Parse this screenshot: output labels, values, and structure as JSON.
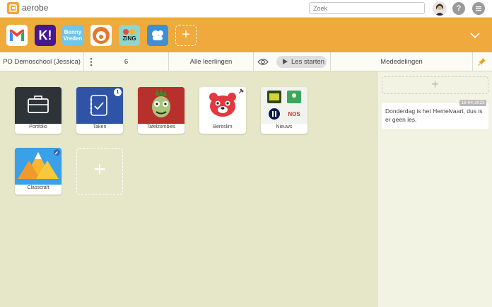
{
  "topbar": {
    "brand": "aerobe",
    "search_placeholder": "Zoek",
    "help_label": "?"
  },
  "apps": [
    {
      "name": "gmail-icon",
      "label": ""
    },
    {
      "name": "kahoot-icon",
      "label": "K!"
    },
    {
      "name": "benny-vreden-icon",
      "label": "Benny Vreden"
    },
    {
      "name": "bereslim-small-icon",
      "label": ""
    },
    {
      "name": "zing-icon",
      "label": "ZING"
    },
    {
      "name": "teams-icon",
      "label": ""
    }
  ],
  "add_app_label": "+",
  "toolbar": {
    "school": "PO Demoschool (Jessica)",
    "count": "6",
    "students": "Alle leerlingen",
    "start_label": "Les starten",
    "announcements": "Mededelingen"
  },
  "tiles": [
    {
      "label": "Portfolio",
      "icon": "briefcase-icon"
    },
    {
      "label": "Taken",
      "icon": "checklist-icon",
      "badge": "1"
    },
    {
      "label": "Tafelzombies",
      "icon": "zombie-icon"
    },
    {
      "label": "Bereslim",
      "icon": "bear-icon"
    },
    {
      "label": "Nieuws",
      "icon": "news-icon"
    },
    {
      "label": "Classcraft",
      "icon": "mountain-icon"
    }
  ],
  "add_tile_label": "+",
  "panel": {
    "add_label": "+",
    "note_date": "18-04-2023",
    "note_text": "Donderdag is het Hemelvaart, dus is er geen les."
  },
  "colors": {
    "orange": "#efa93c",
    "main_bg": "#e6e6c8",
    "panel_bg": "#f3f3e4"
  }
}
